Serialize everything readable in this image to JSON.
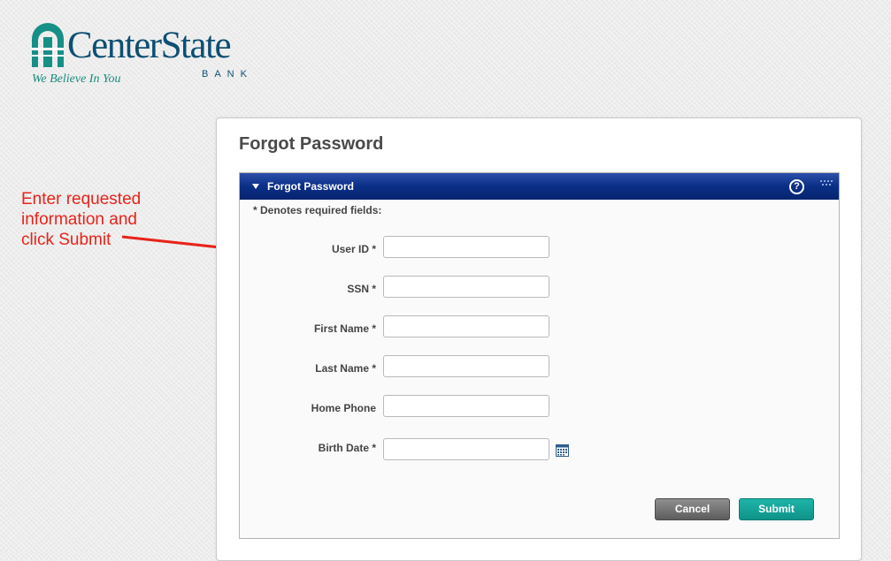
{
  "logo": {
    "name": "CenterState",
    "sub": "BANK",
    "tagline": "We Believe In You"
  },
  "annotation": {
    "text": "Enter requested information and click Submit"
  },
  "page": {
    "title": "Forgot Password"
  },
  "panel": {
    "title": "Forgot Password",
    "required_note": "* Denotes required fields:",
    "help_icon": "help-icon"
  },
  "form": {
    "fields": [
      {
        "label": "User ID *",
        "value": ""
      },
      {
        "label": "SSN *",
        "value": ""
      },
      {
        "label": "First Name *",
        "value": ""
      },
      {
        "label": "Last Name *",
        "value": ""
      },
      {
        "label": "Home Phone",
        "value": ""
      },
      {
        "label": "Birth Date *",
        "value": ""
      }
    ]
  },
  "buttons": {
    "cancel": "Cancel",
    "submit": "Submit"
  },
  "colors": {
    "brand": "#0e4f73",
    "accent": "#1fb4a9",
    "header": "#0a2f87",
    "annotation": "#e8231a"
  }
}
